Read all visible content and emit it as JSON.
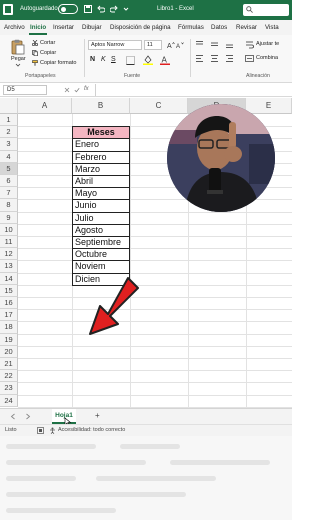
{
  "titlebar": {
    "autosave_label": "Autoguardado",
    "doc_title": "Libro1 - Excel"
  },
  "tabs": [
    "Archivo",
    "Inicio",
    "Insertar",
    "Dibujar",
    "Disposición de página",
    "Fórmulas",
    "Datos",
    "Revisar",
    "Vista"
  ],
  "ribbon": {
    "paste_label": "Pegar",
    "cut_label": "Cortar",
    "copy_label": "Copiar",
    "format_painter_label": "Copiar formato",
    "clipboard_group": "Portapapeles",
    "font_name": "Aptos Narrow",
    "font_size": "11",
    "font_group": "Fuente",
    "wrap_text_label": "Ajustar te",
    "merge_label": "Combina",
    "alignment_group": "Alineación",
    "bold": "N",
    "italic": "K",
    "underline": "S"
  },
  "formula_bar": {
    "name_box": "D5",
    "fx": "fx",
    "content": ""
  },
  "grid": {
    "columns": [
      "A",
      "B",
      "C",
      "D",
      "E"
    ],
    "selected_column": "D",
    "selected_row": 5,
    "rows": [
      "1",
      "2",
      "3",
      "4",
      "5",
      "6",
      "7",
      "8",
      "9",
      "10",
      "11",
      "12",
      "13",
      "14",
      "15",
      "16",
      "17",
      "18",
      "19",
      "20",
      "21",
      "22",
      "23",
      "24"
    ],
    "table_header": "Meses",
    "months": [
      "Enero",
      "Febrero",
      "Marzo",
      "Abril",
      "Mayo",
      "Junio",
      "Julio",
      "Agosto",
      "Septiembre",
      "Octubre",
      "Noviem",
      "Dicien"
    ]
  },
  "sheets": {
    "active": "Hoja1",
    "add_label": "+"
  },
  "status": {
    "ready": "Listo",
    "accessibility": "Accesibilidad: todo correcto"
  },
  "colors": {
    "excel_green": "#1e7145",
    "header_fill": "#f4b6c2",
    "arrow_red": "#e02020"
  }
}
